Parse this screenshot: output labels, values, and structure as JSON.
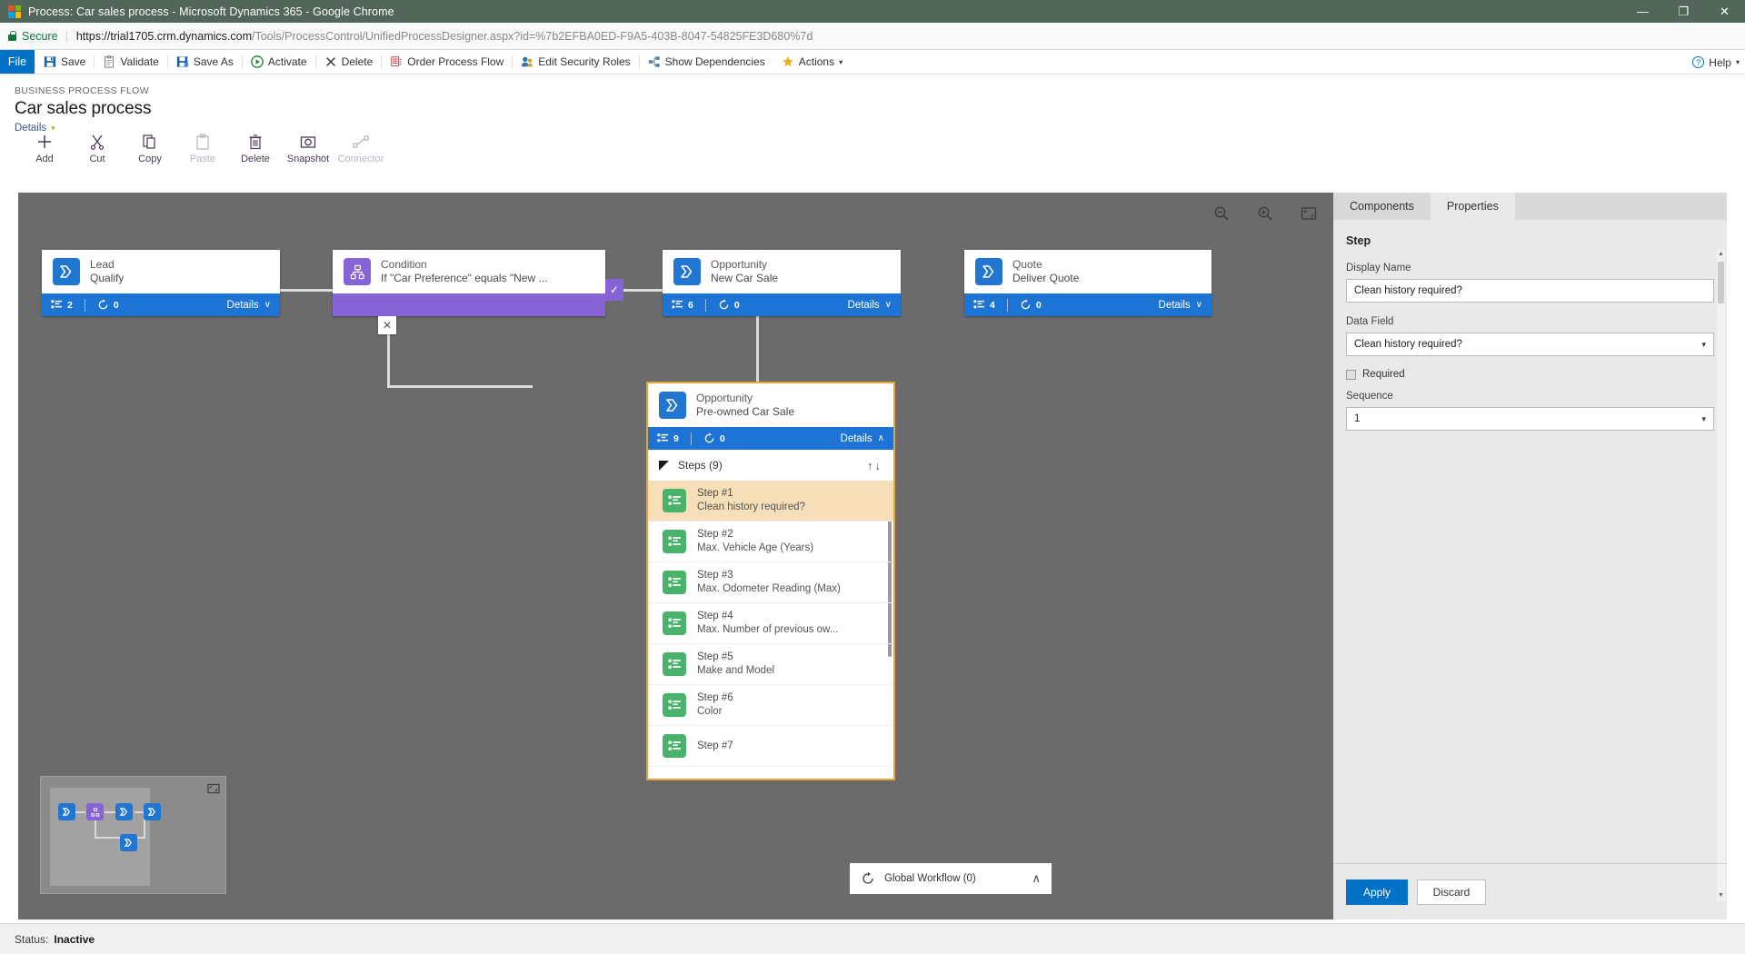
{
  "browser": {
    "window_title": "Process: Car sales process - Microsoft Dynamics 365 - Google Chrome",
    "security_label": "Secure",
    "url_host": "https://trial1705.crm.dynamics.com",
    "url_path": "/Tools/ProcessControl/UnifiedProcessDesigner.aspx?id=%7b2EFBA0ED-F9A5-403B-8047-54825FE3D680%7d",
    "minimize": "—",
    "maximize": "❐",
    "close": "✕"
  },
  "command_bar": {
    "file": "File",
    "items": [
      {
        "label": "Save",
        "icon": "save-icon"
      },
      {
        "label": "Validate",
        "icon": "validate-icon"
      },
      {
        "label": "Save As",
        "icon": "save-as-icon"
      },
      {
        "label": "Activate",
        "icon": "activate-icon"
      },
      {
        "label": "Delete",
        "icon": "delete-icon"
      },
      {
        "label": "Order Process Flow",
        "icon": "order-process-flow-icon"
      },
      {
        "label": "Edit Security Roles",
        "icon": "edit-security-roles-icon"
      },
      {
        "label": "Show Dependencies",
        "icon": "show-dependencies-icon"
      },
      {
        "label": "Actions",
        "icon": "actions-icon"
      }
    ],
    "help_label": "Help",
    "help_caret": "▾",
    "actions_caret": "▾"
  },
  "page_header": {
    "eyebrow": "BUSINESS PROCESS FLOW",
    "title": "Car sales process",
    "details_link": "Details",
    "details_caret": "▾"
  },
  "design_toolbar": [
    {
      "label": "Add",
      "icon": "plus-icon",
      "disabled": false
    },
    {
      "label": "Cut",
      "icon": "scissors-icon",
      "disabled": false
    },
    {
      "label": "Copy",
      "icon": "copy-icon",
      "disabled": false
    },
    {
      "label": "Paste",
      "icon": "paste-icon",
      "disabled": true
    },
    {
      "label": "Delete",
      "icon": "trash-icon",
      "disabled": false
    },
    {
      "label": "Snapshot",
      "icon": "camera-icon",
      "disabled": false
    },
    {
      "label": "Connector",
      "icon": "connector-icon",
      "disabled": true
    }
  ],
  "canvas": {
    "zoom_out_icon": "zoom-out-icon",
    "zoom_in_icon": "zoom-in-icon",
    "fit_icon": "fit-to-screen-icon",
    "stages": [
      {
        "entity": "Lead",
        "name": "Qualify",
        "steps_count": "2",
        "workflow_count": "0",
        "details_label": "Details",
        "details_caret": "∨",
        "type": "stage"
      },
      {
        "entity": "Condition",
        "name": "If \"Car Preference\" equals \"New ...",
        "type": "condition",
        "check_glyph": "✓",
        "x_glyph": "✕"
      },
      {
        "entity": "Opportunity",
        "name": "New Car Sale",
        "steps_count": "6",
        "workflow_count": "0",
        "details_label": "Details",
        "details_caret": "∨",
        "type": "stage"
      },
      {
        "entity": "Quote",
        "name": "Deliver Quote",
        "steps_count": "4",
        "workflow_count": "0",
        "details_label": "Details",
        "details_caret": "∨",
        "type": "stage"
      },
      {
        "entity": "Opportunity",
        "name": "Pre-owned Car Sale",
        "steps_count": "9",
        "workflow_count": "0",
        "details_label": "Details",
        "details_caret": "∧",
        "type": "stage-selected"
      }
    ],
    "steps_panel": {
      "header": "Steps (9)",
      "move_up_icon": "arrow-up-icon",
      "move_down_icon": "arrow-down-icon",
      "steps": [
        {
          "number": "Step #1",
          "name": "Clean history required?",
          "selected": true
        },
        {
          "number": "Step #2",
          "name": "Max. Vehicle Age (Years)",
          "selected": false
        },
        {
          "number": "Step #3",
          "name": "Max. Odometer Reading (Max)",
          "selected": false
        },
        {
          "number": "Step #4",
          "name": "Max. Number of previous ow...",
          "selected": false
        },
        {
          "number": "Step #5",
          "name": "Make and Model",
          "selected": false
        },
        {
          "number": "Step #6",
          "name": "Color",
          "selected": false
        },
        {
          "number": "Step #7",
          "name": "",
          "selected": false
        }
      ]
    },
    "global_workflow": {
      "label": "Global Workflow (0)",
      "icon": "workflow-icon",
      "caret": "∧"
    },
    "minimap": {
      "expand_icon": "expand-minimap-icon"
    }
  },
  "right_panel": {
    "tabs": [
      {
        "label": "Components",
        "active": false
      },
      {
        "label": "Properties",
        "active": true
      }
    ],
    "section_title": "Step",
    "display_name_label": "Display Name",
    "display_name_value": "Clean history required?",
    "data_field_label": "Data Field",
    "data_field_value": "Clean history required?",
    "required_label": "Required",
    "required_checked": false,
    "sequence_label": "Sequence",
    "sequence_value": "1",
    "select_caret": "▾",
    "apply_label": "Apply",
    "discard_label": "Discard"
  },
  "status_bar": {
    "label": "Status:",
    "value": "Inactive"
  },
  "colors": {
    "accent_blue": "#0072c6",
    "stage_blue": "#1e74d4",
    "condition_purple": "#8764d5",
    "step_green": "#49b36b",
    "selected_orange": "#e8a33d",
    "canvas_gray": "#6b6b6b",
    "titlebar": "#52665a"
  }
}
